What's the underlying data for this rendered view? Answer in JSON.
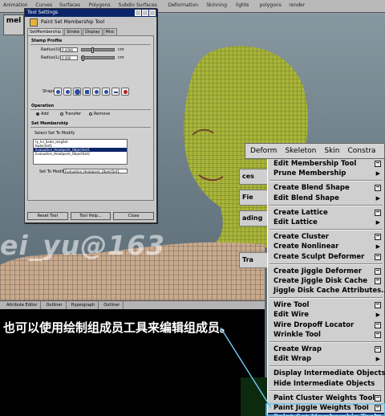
{
  "topbar": {
    "items": [
      "Animation",
      "Curves",
      "Surfaces",
      "Polygons",
      "Subdiv Surfaces",
      "Deformation",
      "Skinning",
      "lights",
      "polygons",
      "render"
    ]
  },
  "shelf": {
    "label": "mel"
  },
  "watermark": {
    "text": "ei_yu@163"
  },
  "tool_settings": {
    "window_title": "Tool Settings",
    "tool_name": "Paint Set Membership Tool",
    "tabs": [
      "SetMembership",
      "Stroke",
      "Display",
      "Misc"
    ],
    "stamp_profile": {
      "heading": "Stamp Profile",
      "radius_u_label": "Radius(U)",
      "radius_u_value": "0.4396",
      "radius_l_label": "Radius(L)",
      "radius_l_value": "0.000",
      "unit": "cm",
      "shape_label": "Shape"
    },
    "operation": {
      "heading": "Operation",
      "options": [
        "Add",
        "Transfer",
        "Remove"
      ]
    },
    "set_membership": {
      "heading": "Set Membership",
      "list_label": "Select Set To Modify",
      "sets": [
        "ty_lnl_Sales_lengSet",
        "bwlenSet1",
        "Evaluation_Headpoint_ObjectSet1",
        "Evaluation_Headpoint_ObjectSet2"
      ],
      "selected_index": 2,
      "modify_label": "Set To Modify",
      "modify_value": "Evaluation_Headpoint_ObjectSet1"
    },
    "buttons": [
      "Reset Tool",
      "Tool Help...",
      "Close"
    ]
  },
  "attribute_bar": {
    "items": [
      "Attribute Editor",
      "Outliner",
      "Hypergraph",
      "Outliner"
    ]
  },
  "caption": {
    "text": "也可以使用绘制组成员工具来编辑组成员。"
  },
  "menubar": {
    "items": [
      "Deform",
      "Skeleton",
      "Skin",
      "Constra"
    ]
  },
  "background_tabs": [
    "ces",
    "Fie",
    "ading",
    "Tra"
  ],
  "menu": {
    "groups": [
      [
        {
          "label": "Edit Membership Tool",
          "opt": true,
          "arrow": false
        },
        {
          "label": "Prune Membership",
          "opt": false,
          "arrow": true
        }
      ],
      [
        {
          "label": "Create Blend Shape",
          "opt": true,
          "arrow": false
        },
        {
          "label": "Edit Blend Shape",
          "opt": false,
          "arrow": true
        }
      ],
      [
        {
          "label": "Create Lattice",
          "opt": true,
          "arrow": false
        },
        {
          "label": "Edit Lattice",
          "opt": false,
          "arrow": true
        }
      ],
      [
        {
          "label": "Create Cluster",
          "opt": true,
          "arrow": false
        },
        {
          "label": "Create Nonlinear",
          "opt": false,
          "arrow": true
        },
        {
          "label": "Create Sculpt Deformer",
          "opt": true,
          "arrow": false
        }
      ],
      [
        {
          "label": "Create Jiggle Deformer",
          "opt": true,
          "arrow": false
        },
        {
          "label": "Create Jiggle Disk Cache",
          "opt": true,
          "arrow": false
        },
        {
          "label": "Jiggle Disk Cache Attributes...",
          "opt": false,
          "arrow": false
        }
      ],
      [
        {
          "label": "Wire Tool",
          "opt": true,
          "arrow": false
        },
        {
          "label": "Edit Wire",
          "opt": false,
          "arrow": true
        },
        {
          "label": "Wire Dropoff Locator",
          "opt": true,
          "arrow": false
        },
        {
          "label": "Wrinkle Tool",
          "opt": true,
          "arrow": false
        }
      ],
      [
        {
          "label": "Create Wrap",
          "opt": true,
          "arrow": false
        },
        {
          "label": "Edit Wrap",
          "opt": false,
          "arrow": true
        }
      ],
      [
        {
          "label": "Display Intermediate Objects",
          "opt": false,
          "arrow": false
        },
        {
          "label": "Hide Intermediate Objects",
          "opt": false,
          "arrow": false
        }
      ],
      [
        {
          "label": "Paint Cluster Weights Tool",
          "opt": true,
          "arrow": false
        },
        {
          "label": "Paint Jiggle Weights Tool",
          "opt": true,
          "arrow": false
        },
        {
          "label": "Paint Set Membership Tool",
          "opt": true,
          "arrow": false,
          "highlighted": true
        }
      ]
    ]
  },
  "colors": {
    "mesh": "#a9b53a",
    "wire": "#4a5210",
    "highlight": "#0a246a",
    "console": "#000000"
  }
}
